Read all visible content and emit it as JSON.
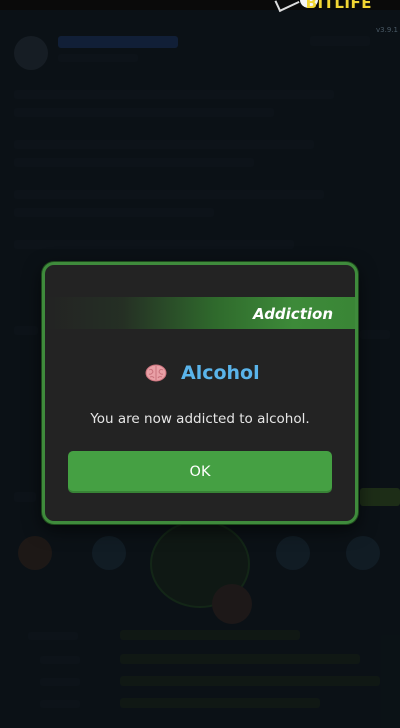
{
  "header": {
    "logo_text": "BITLIFE",
    "version": "v3.9.1"
  },
  "dialog": {
    "banner": "Addiction",
    "title_icon": "brain-icon",
    "title": "Alcohol",
    "message": "You are now addicted to alcohol.",
    "ok_label": "OK"
  },
  "colors": {
    "accent_green": "#45a043",
    "border_green": "#3f8b3c",
    "title_blue": "#5ab4ea",
    "modal_bg": "#232323"
  }
}
